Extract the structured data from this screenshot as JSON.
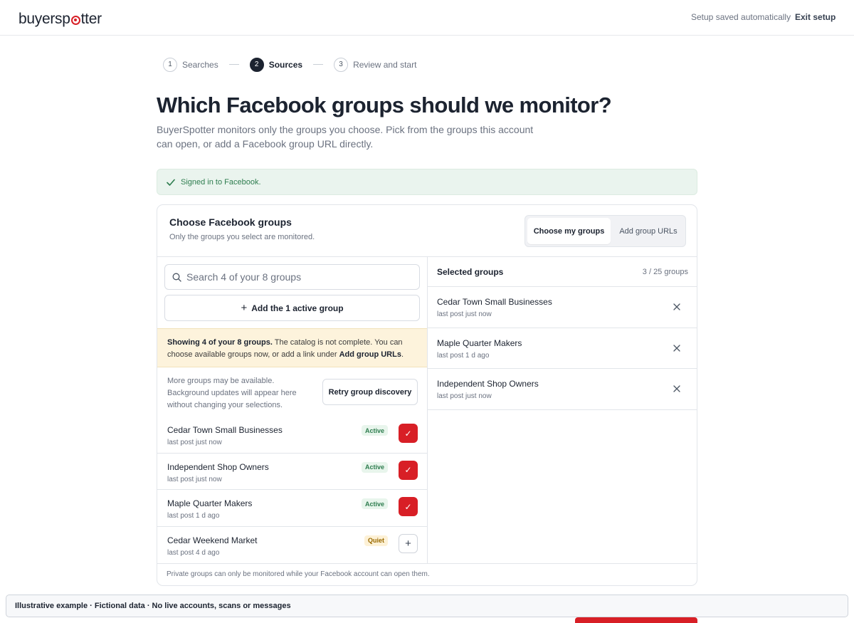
{
  "header": {
    "logo_prefix": "buyersp",
    "logo_suffix": "tter",
    "saved_status": "Setup saved automatically",
    "exit_label": "Exit setup"
  },
  "stepper": [
    {
      "num": "1",
      "label": "Searches",
      "active": false
    },
    {
      "num": "2",
      "label": "Sources",
      "active": true
    },
    {
      "num": "3",
      "label": "Review and start",
      "active": false
    }
  ],
  "page": {
    "title": "Which Facebook groups should we monitor?",
    "subtitle": "BuyerSpotter monitors only the groups you choose. Pick from the groups this account can open, or add a Facebook group URL directly.",
    "signed_in": "Signed in to Facebook."
  },
  "card": {
    "title": "Choose Facebook groups",
    "subtitle": "Only the groups you select are monitored.",
    "seg_left": "Choose my groups",
    "seg_right": "Add group URLs",
    "search_placeholder": "Search 4 of your 8 groups",
    "add_active_label": "Add the 1 active group",
    "warning_bold": "Showing 4 of your 8 groups.",
    "warning_text": " The catalog is not complete. You can choose available groups now, or add a link under ",
    "warning_link": "Add group URLs",
    "warning_end": ".",
    "more_text": "More groups may be available. Background updates will appear here without changing your selections.",
    "retry_label": "Retry group discovery",
    "footer": "Private groups can only be monitored while your Facebook account can open them."
  },
  "groups": [
    {
      "name": "Cedar Town Small Businesses",
      "meta": "last post just now",
      "badge": "Active",
      "selected": true
    },
    {
      "name": "Independent Shop Owners",
      "meta": "last post just now",
      "badge": "Active",
      "selected": true
    },
    {
      "name": "Maple Quarter Makers",
      "meta": "last post 1 d ago",
      "badge": "Active",
      "selected": true
    },
    {
      "name": "Cedar Weekend Market",
      "meta": "last post 4 d ago",
      "badge": "Quiet",
      "selected": false
    }
  ],
  "selected": {
    "title": "Selected groups",
    "count": "3 / 25 groups",
    "items": [
      {
        "name": "Cedar Town Small Businesses",
        "meta": "last post just now"
      },
      {
        "name": "Maple Quarter Makers",
        "meta": "last post 1 d ago"
      },
      {
        "name": "Independent Shop Owners",
        "meta": "last post just now"
      }
    ]
  },
  "notice": "Illustrative example · Fictional data · No live accounts, scans or messages",
  "colors": {
    "brand_red": "#d81f26",
    "success_green": "#2e7d4f",
    "warning_bg": "#fdf3dc"
  },
  "icons": {
    "check": "✓",
    "plus": "+",
    "close": "×"
  }
}
